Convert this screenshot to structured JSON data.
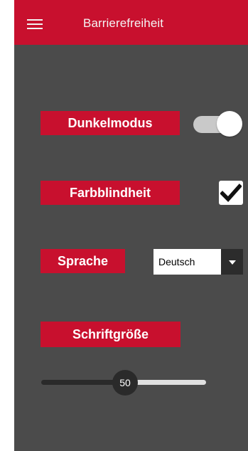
{
  "header": {
    "title": "Barrierefreiheit",
    "menu_icon": "hamburger-menu-icon"
  },
  "settings": {
    "dark_mode": {
      "label": "Dunkelmodus",
      "enabled": true
    },
    "color_blindness": {
      "label": "Farbblindheit",
      "checked": true
    },
    "language": {
      "label": "Sprache",
      "selected": "Deutsch"
    },
    "font_size": {
      "label": "Schriftgröße",
      "value": "50"
    }
  },
  "colors": {
    "accent": "#c8102e",
    "background": "#4b4b4b"
  }
}
